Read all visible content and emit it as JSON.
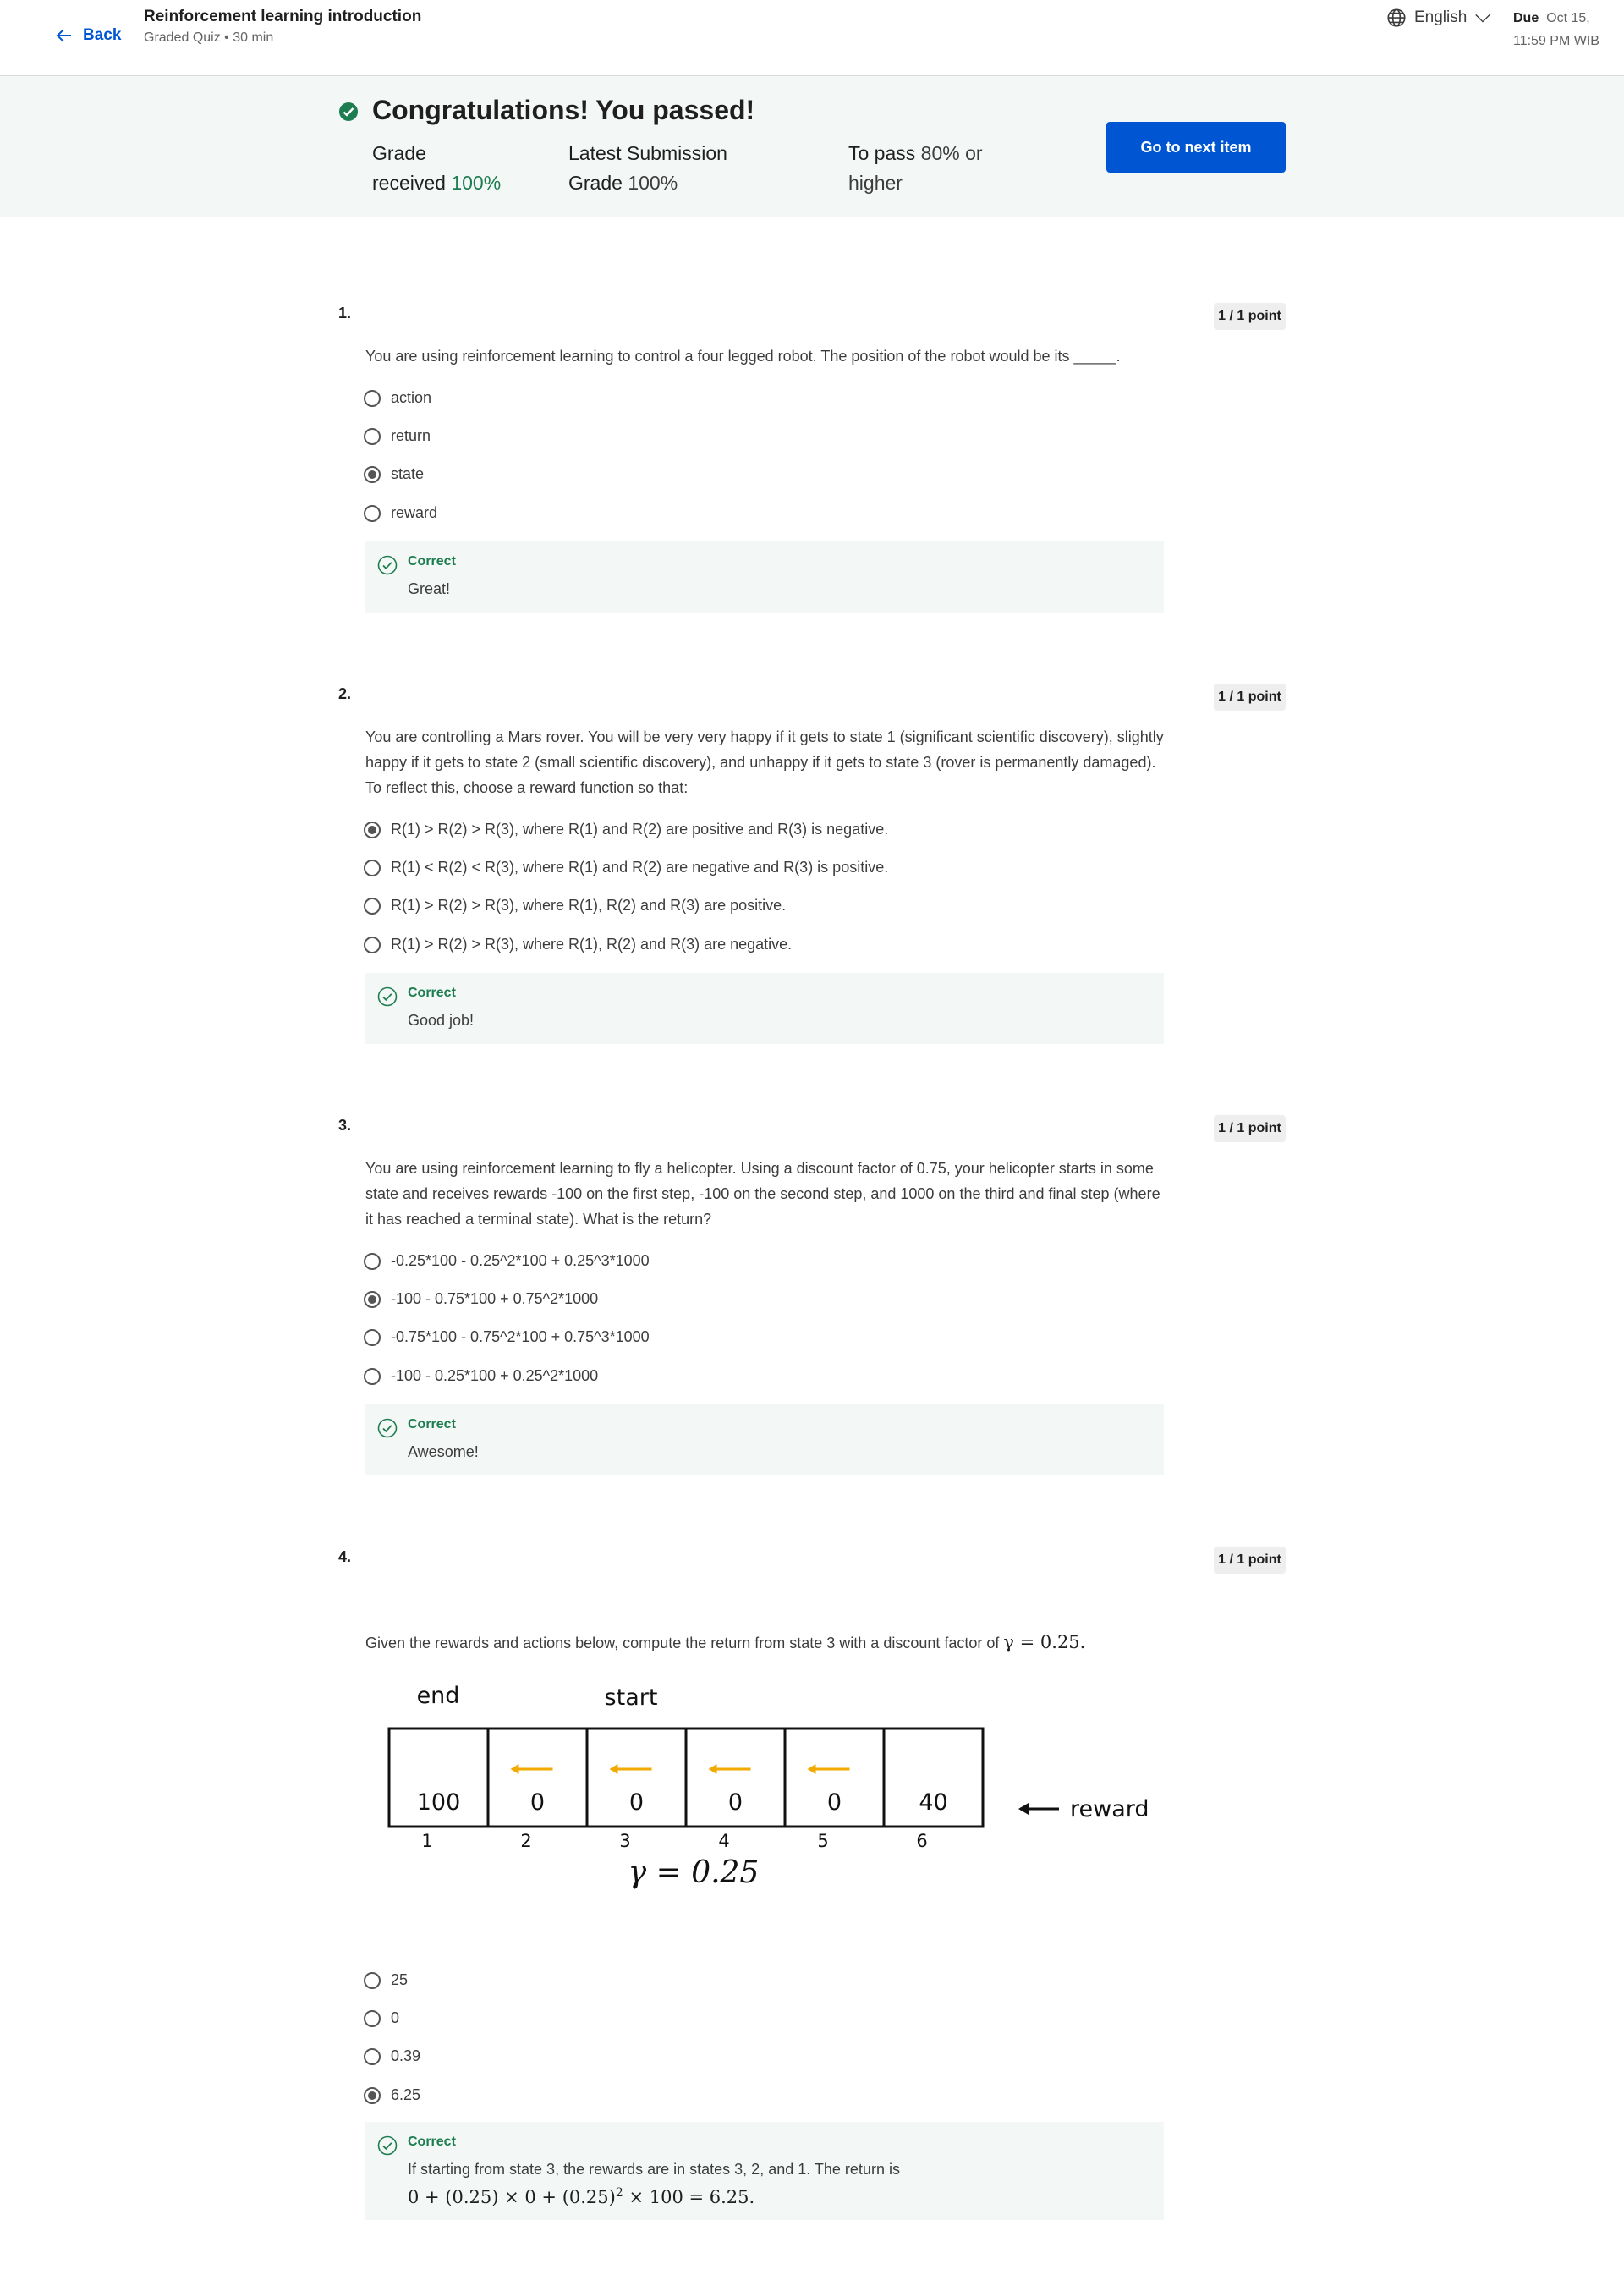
{
  "header": {
    "back_label": "Back",
    "course_title": "Reinforcement learning introduction",
    "course_subtitle": "Graded Quiz • 30 min",
    "language": "English",
    "due_label": "Due",
    "due_date": "Oct 15,",
    "due_time": "11:59 PM WIB"
  },
  "banner": {
    "headline": "Congratulations! You passed!",
    "grade_label_1": "Grade",
    "grade_label_2": "received",
    "grade_value": "100%",
    "latest_label_1": "Latest Submission",
    "latest_label_2": "Grade",
    "latest_value": "100%",
    "pass_label": "To pass",
    "pass_value": "80% or",
    "pass_value_2": "higher",
    "next_button": "Go to next item"
  },
  "questions": [
    {
      "number": "1.",
      "points": "1 / 1 point",
      "text": "You are using reinforcement learning to control a four legged robot. The position of the robot would be its _____.",
      "options": [
        "action",
        "return",
        "state",
        "reward"
      ],
      "selected_index": 2,
      "feedback_title": "Correct",
      "feedback_text": "Great!"
    },
    {
      "number": "2.",
      "points": "1 / 1 point",
      "text": "You are controlling a Mars rover. You will be very very happy if it gets to state 1 (significant scientific discovery), slightly happy if it gets to state 2 (small scientific discovery), and unhappy if it gets to state 3 (rover is permanently damaged). To reflect this, choose a reward function so that:",
      "options": [
        "R(1) > R(2) > R(3), where R(1) and R(2) are positive and R(3) is negative.",
        "R(1) < R(2) < R(3), where R(1) and R(2) are negative and R(3) is positive.",
        "R(1) > R(2) > R(3), where R(1), R(2) and R(3) are positive.",
        "R(1) > R(2) > R(3), where R(1), R(2) and R(3) are negative."
      ],
      "selected_index": 0,
      "feedback_title": "Correct",
      "feedback_text": "Good job!"
    },
    {
      "number": "3.",
      "points": "1 / 1 point",
      "text": "You are using reinforcement learning to fly a helicopter. Using a discount factor of 0.75, your helicopter starts in some state and receives rewards -100 on the first step, -100 on the second step, and 1000 on the third and final step (where it has reached a terminal state). What is the return?",
      "options": [
        "-0.25*100 - 0.25^2*100 + 0.25^3*1000",
        "-100 - 0.75*100 + 0.75^2*1000",
        "-0.75*100 - 0.75^2*100 + 0.75^3*1000",
        "-100 - 0.25*100 + 0.25^2*1000"
      ],
      "selected_index": 1,
      "feedback_title": "Correct",
      "feedback_text": "Awesome!"
    },
    {
      "number": "4.",
      "points": "1 / 1 point",
      "text": "Given the rewards and actions below, compute the return from state 3 with a discount factor of",
      "text_math": "γ = 0.25.",
      "options": [
        "25",
        "0",
        "0.39",
        "6.25"
      ],
      "selected_index": 3,
      "feedback_title": "Correct",
      "feedback_text": "If starting from state 3, the rewards are in states 3, 2, and 1. The return is",
      "feedback_math": "0 + (0.25) × 0 + (0.25)",
      "feedback_math_sup": "2",
      "feedback_math_tail": " × 100 = 6.25."
    }
  ],
  "diagram": {
    "end_label": "end",
    "start_label": "start",
    "rewards": [
      "100",
      "0",
      "0",
      "0",
      "0",
      "40"
    ],
    "states": [
      "1",
      "2",
      "3",
      "4",
      "5",
      "6"
    ],
    "reward_label": "reward",
    "gamma_label": "γ = 0.25",
    "arrow_color": "#f2a900"
  },
  "colors": {
    "accent": "#0056d2",
    "success": "#1d7c50",
    "banner_bg": "#f3f8f6"
  }
}
